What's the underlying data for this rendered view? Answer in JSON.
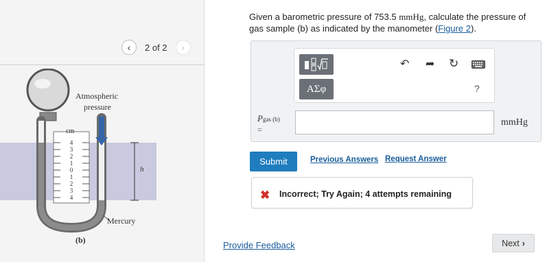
{
  "figure_nav": {
    "prev_icon": "chevron-left-icon",
    "counter": "2 of 2",
    "next_icon": "chevron-right-icon"
  },
  "figure": {
    "label_atmospheric": "Atmospheric",
    "label_pressure": "pressure",
    "scale_unit": "cm",
    "scale_ticks": [
      "4",
      "3",
      "2",
      "1",
      "0",
      "1",
      "2",
      "3",
      "4"
    ],
    "label_h": "h",
    "label_mercury": "Mercury",
    "caption": "(b)",
    "colors": {
      "band": "#c9c9df",
      "arrow": "#3565a8"
    }
  },
  "question": {
    "prefix": "Given a barometric pressure of 753.5 ",
    "unit": "mmHg",
    "middle": ", calculate the pressure of gas sample (b) as indicated by the manometer (",
    "link": "Figure 2",
    "suffix": ")."
  },
  "toolbar": {
    "template_icon": "fraction-sqrt-template-icon",
    "symbols_label": "ΑΣφ",
    "undo_icon": "undo-icon",
    "redo_icon": "redo-icon",
    "reset_icon": "reset-icon",
    "keyboard_icon": "keyboard-icon",
    "help_label": "?"
  },
  "answer": {
    "label_main": "P",
    "label_sub": "gas (b)",
    "label_eq": "=",
    "value": "",
    "unit": "mmHg"
  },
  "actions": {
    "submit": "Submit",
    "previous_answers": "Previous Answers",
    "request_answer": "Request Answer"
  },
  "feedback": {
    "icon": "x-icon",
    "text": "Incorrect; Try Again; 4 attempts remaining",
    "color": "#d0322b"
  },
  "footer": {
    "provide_feedback": "Provide Feedback",
    "next": "Next"
  },
  "colors": {
    "accent": "#1f7dbd",
    "link": "#1a5d9b"
  }
}
